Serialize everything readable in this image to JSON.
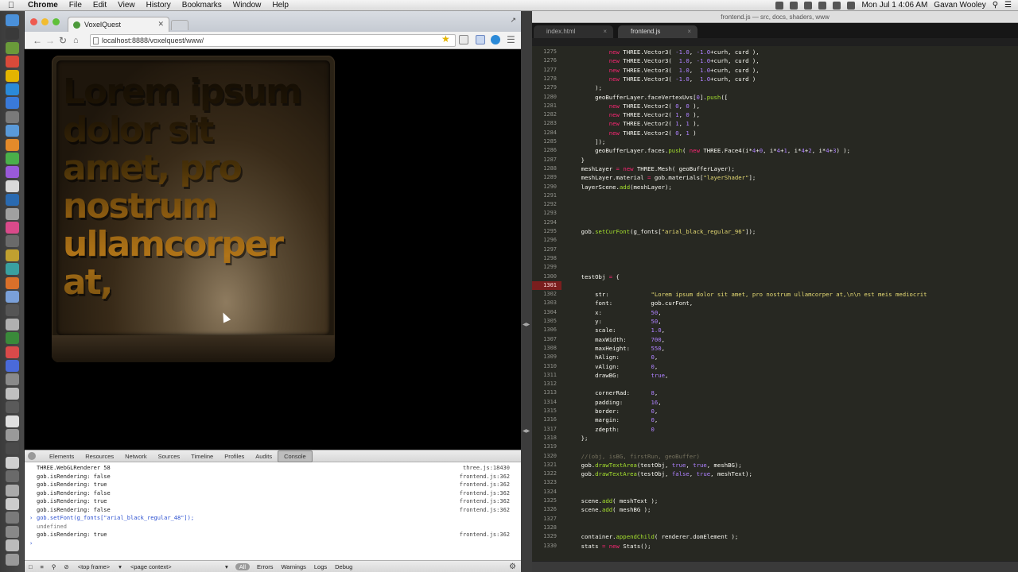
{
  "menubar": {
    "app": "Chrome",
    "items": [
      "File",
      "Edit",
      "View",
      "History",
      "Bookmarks",
      "Window",
      "Help"
    ],
    "clock": "Mon Jul 1  4:06 AM",
    "user": "Gavan Wooley"
  },
  "browser": {
    "tab_title": "VoxelQuest",
    "url": "localhost:8888/voxelquest/www/",
    "canvas_text": "Lorem ipsum dolor sit amet, pro nostrum ullamcorper at,"
  },
  "devtools": {
    "tabs": [
      "Elements",
      "Resources",
      "Network",
      "Sources",
      "Timeline",
      "Profiles",
      "Audits",
      "Console"
    ],
    "active_tab": "Console",
    "lines": [
      {
        "text": "THREE.WebGLRenderer 58",
        "src": "three.js:18430",
        "kind": "log"
      },
      {
        "text": "gob.isRendering: false",
        "src": "frontend.js:362",
        "kind": "log"
      },
      {
        "text": "gob.isRendering: true",
        "src": "frontend.js:362",
        "kind": "log"
      },
      {
        "text": "gob.isRendering: false",
        "src": "frontend.js:362",
        "kind": "log"
      },
      {
        "text": "gob.isRendering: true",
        "src": "frontend.js:362",
        "kind": "log"
      },
      {
        "text": "gob.isRendering: false",
        "src": "frontend.js:362",
        "kind": "log"
      },
      {
        "text": "gob.setFont(g_fonts[\"arial_black_regular_48\"]);",
        "src": "",
        "kind": "cmd"
      },
      {
        "text": "undefined",
        "src": "",
        "kind": "res"
      },
      {
        "text": "gob.isRendering: true",
        "src": "frontend.js:362",
        "kind": "log"
      },
      {
        "text": "",
        "src": "",
        "kind": "prompt"
      }
    ],
    "bottom": {
      "frame": "<top frame>",
      "context": "<page context>",
      "filters": [
        "All",
        "Errors",
        "Warnings",
        "Logs",
        "Debug"
      ]
    }
  },
  "editor": {
    "title": "frontend.js — src, docs, shaders, www",
    "tabs": [
      "index.html",
      "frontend.js"
    ],
    "active_tab": "frontend.js",
    "breakpoint_line": 1301,
    "first_line": 1275,
    "lines": [
      "            new THREE.Vector3( -1.0, -1.0+curh, curd ),",
      "            new THREE.Vector3(  1.0, -1.0+curh, curd ),",
      "            new THREE.Vector3(  1.0,  1.0+curh, curd ),",
      "            new THREE.Vector3( -1.0,  1.0+curh, curd )",
      "        );",
      "        geoBufferLayer.faceVertexUvs[0].push([",
      "            new THREE.Vector2( 0, 0 ),",
      "            new THREE.Vector2( 1, 0 ),",
      "            new THREE.Vector2( 1, 1 ),",
      "            new THREE.Vector2( 0, 1 )",
      "        ]);",
      "        geoBufferLayer.faces.push( new THREE.Face4(i*4+0, i*4+1, i*4+2, i*4+3) );",
      "    }",
      "    meshLayer = new THREE.Mesh( geoBufferLayer);",
      "    meshLayer.material = gob.materials[\"layerShader\"];",
      "    layerScene.add(meshLayer);",
      "",
      "",
      "",
      "",
      "    gob.setCurFont(g_fonts[\"arial_black_regular_96\"]);",
      "",
      "",
      "",
      "",
      "    testObj = {",
      "",
      "        str:            \"Lorem ipsum dolor sit amet, pro nostrum ullamcorper at,\\n\\n est meis mediocrit",
      "        font:           gob.curFont,",
      "        x:              50,",
      "        y:              50,",
      "        scale:          1.0,",
      "        maxWidth:       700,",
      "        maxHeight:      550,",
      "        hAlign:         0,",
      "        vAlign:         0,",
      "        drawBG:         true,",
      "",
      "        cornerRad:      8,",
      "        padding:        16,",
      "        border:         0,",
      "        margin:         0,",
      "        zdepth:         0",
      "    };",
      "",
      "    //(obj, isBG, firstRun, geoBuffer)",
      "    gob.drawTextArea(testObj, true, true, meshBG);",
      "    gob.drawTextArea(testObj, false, true, meshText);",
      "",
      "",
      "    scene.add( meshText );",
      "    scene.add( meshBG );",
      "",
      "",
      "    container.appendChild( renderer.domElement );",
      "    stats = new Stats();"
    ]
  }
}
